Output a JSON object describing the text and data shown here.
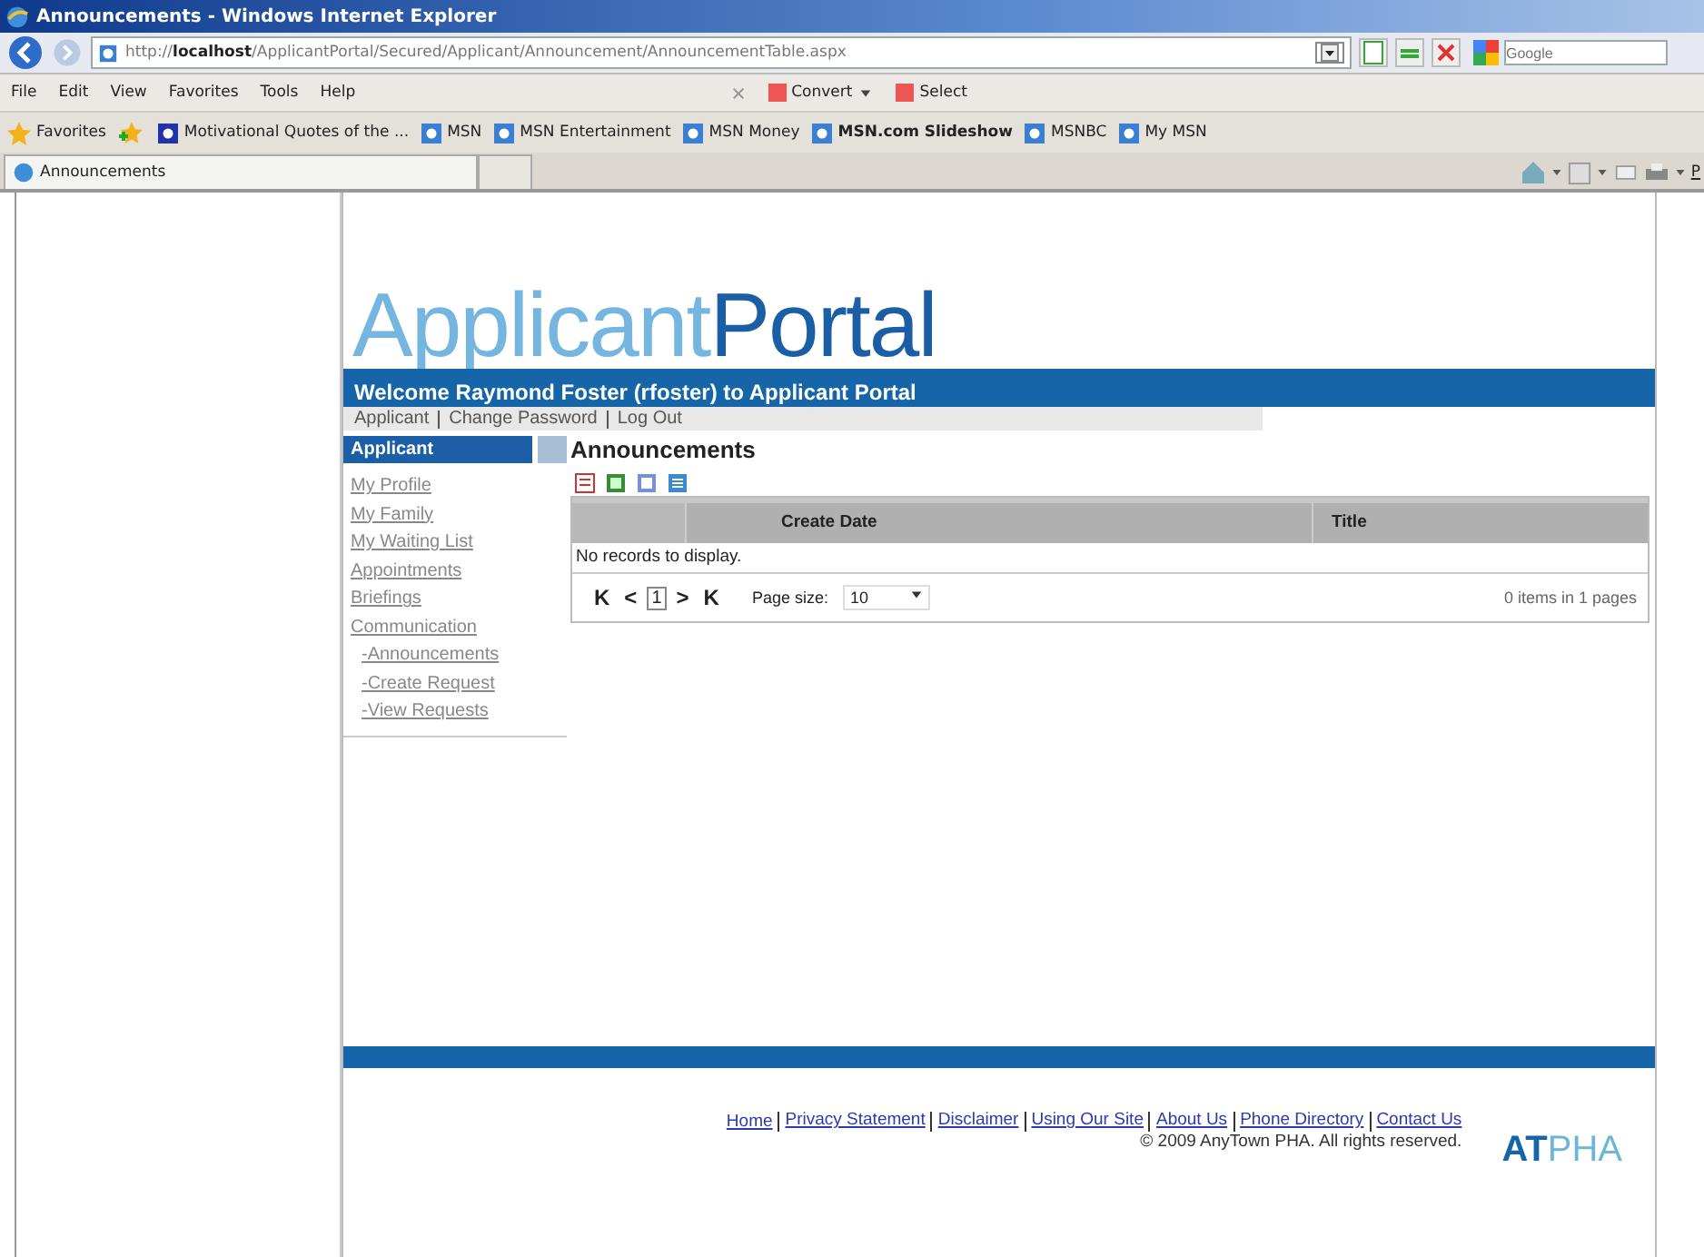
{
  "window": {
    "title": "Announcements - Windows Internet Explorer"
  },
  "address": {
    "url_prefix": "http://",
    "url_host": "localhost",
    "url_path": "/ApplicantPortal/Secured/Applicant/Announcement/AnnouncementTable.aspx",
    "search_placeholder": "Google"
  },
  "menu": [
    "File",
    "Edit",
    "View",
    "Favorites",
    "Tools",
    "Help"
  ],
  "toolbar": [
    {
      "label": "Convert",
      "dropdown": true
    },
    {
      "label": "Select",
      "dropdown": false
    }
  ],
  "favorites": {
    "label": "Favorites",
    "links": [
      {
        "label": "Motivational Quotes of the ...",
        "bold": false
      },
      {
        "label": "MSN",
        "bold": false
      },
      {
        "label": "MSN Entertainment",
        "bold": false
      },
      {
        "label": "MSN Money",
        "bold": false
      },
      {
        "label": "MSN.com Slideshow",
        "bold": true
      },
      {
        "label": "MSNBC",
        "bold": false
      },
      {
        "label": "My MSN",
        "bold": false
      }
    ]
  },
  "tabs": [
    {
      "label": "Announcements"
    }
  ],
  "command_bar": {
    "page_label": "P"
  },
  "site": {
    "logo_light": "Applicant",
    "logo_dark": "Portal",
    "welcome": "Welcome Raymond Foster (rfoster) to Applicant Portal",
    "top_links": [
      "Applicant",
      "Change Password",
      "Log Out"
    ],
    "sidebar": {
      "heading": "Applicant",
      "items": [
        {
          "label": "My Profile"
        },
        {
          "label": "My Family"
        },
        {
          "label": "My Waiting List"
        },
        {
          "label": "Appointments"
        },
        {
          "label": "Briefings"
        },
        {
          "label": "Communication",
          "children": [
            {
              "label": "-Announcements"
            },
            {
              "label": "-Create Request"
            },
            {
              "label": "-View Requests"
            }
          ]
        }
      ]
    },
    "page_title": "Announcements",
    "grid": {
      "columns": [
        "Create Date",
        "Title"
      ],
      "empty_message": "No records to display.",
      "pager": {
        "first": "K",
        "prev": "<",
        "page": "1",
        "next": ">",
        "last": "K",
        "page_size_label": "Page size:",
        "page_size": "10",
        "summary": "0 items in 1 pages"
      }
    },
    "footer": {
      "links": [
        "Home",
        "Privacy Statement",
        "Disclaimer",
        "Using Our Site",
        "About Us",
        "Phone Directory",
        "Contact Us"
      ],
      "copyright": "© 2009 AnyTown PHA. All rights reserved.",
      "logo_dark": "AT",
      "logo_light": "PHA"
    }
  }
}
